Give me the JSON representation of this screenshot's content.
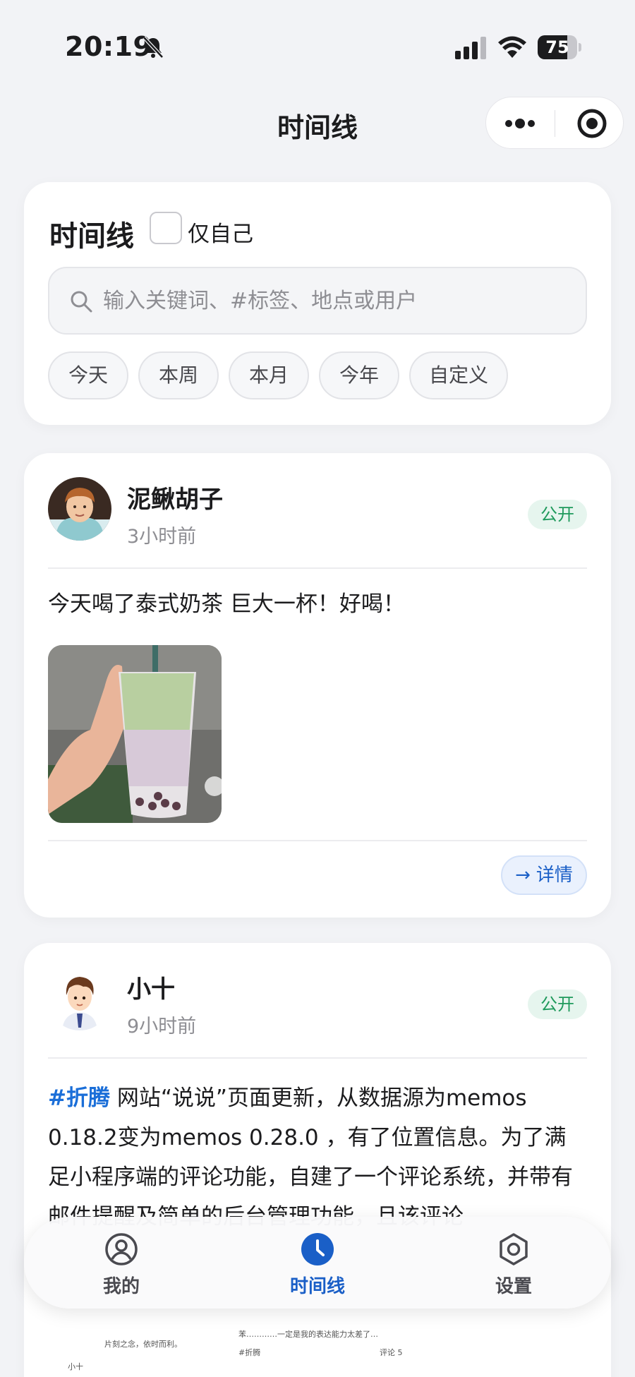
{
  "status_bar": {
    "time": "20:19",
    "battery": "75",
    "battery_level": 0.75
  },
  "nav": {
    "title": "时间线"
  },
  "filter": {
    "title": "时间线",
    "only_self_label": "仅自己",
    "search_placeholder": "输入关键词、#标签、地点或用户",
    "chips": [
      "今天",
      "本周",
      "本月",
      "今年",
      "自定义"
    ]
  },
  "posts": [
    {
      "author": "泥鳅胡子",
      "time": "3小时前",
      "visibility": "公开",
      "text": "今天喝了泰式奶茶 巨大一杯！好喝！",
      "detail_label": "详情"
    },
    {
      "author": "小十",
      "time": "9小时前",
      "visibility": "公开",
      "tag": "#折腾",
      "text": " 网站“说说”页面更新，从数据源为memos 0.18.2变为memos 0.28.0 ，有了位置信息。为了满足小程序端的评论功能，自建了一个评论系统，并带有邮件提醒及简单的后台管理功能，且该评论",
      "screenshot_texts": {
        "left_caption": "片刻之念，依时而利。",
        "right_caption": "苯…………一定是我的表达能力太差了…",
        "tag": "#折腾",
        "comments": "评论 5",
        "user": "小十"
      }
    }
  ],
  "tabbar": {
    "items": [
      {
        "label": "我的",
        "icon": "person-icon"
      },
      {
        "label": "时间线",
        "icon": "clock-icon"
      },
      {
        "label": "设置",
        "icon": "hexagon-gear-icon"
      }
    ],
    "active_color": "#1a5fc7"
  },
  "colors": {
    "accent": "#1a5fc7",
    "public_badge": "#1f9a5c",
    "tag": "#1a6ed8"
  }
}
